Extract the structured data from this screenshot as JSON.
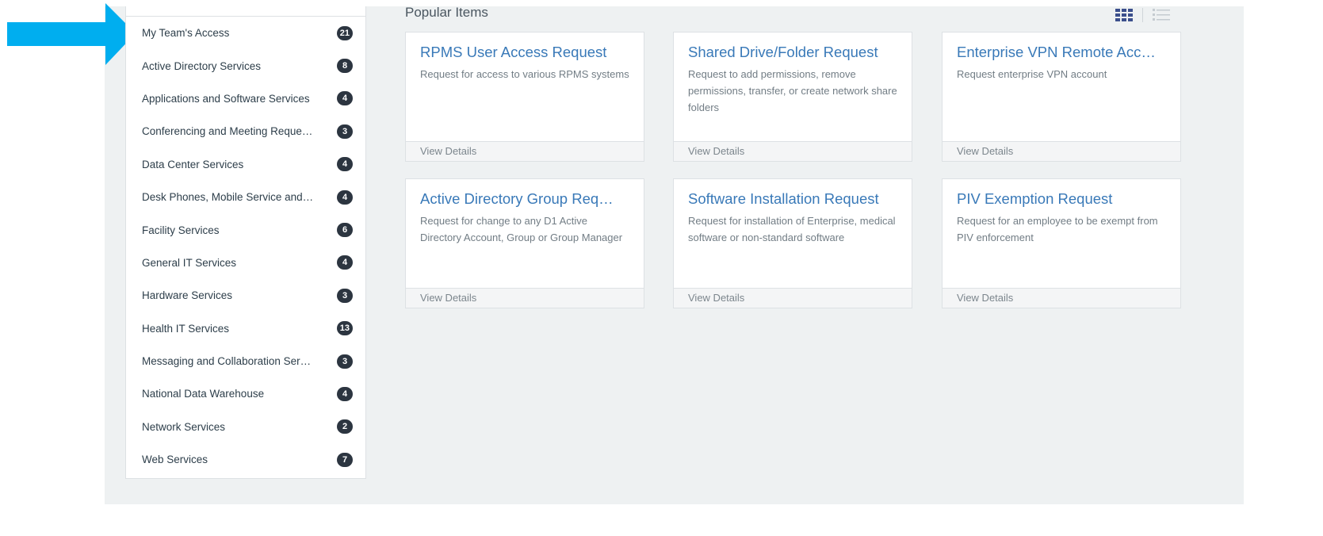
{
  "sidebar": {
    "items": [
      {
        "label": "My Team's Access",
        "count": "21"
      },
      {
        "label": "Active Directory Services",
        "count": "8"
      },
      {
        "label": "Applications and Software Services",
        "count": "4"
      },
      {
        "label": "Conferencing and Meeting Reque…",
        "count": "3"
      },
      {
        "label": "Data Center Services",
        "count": "4"
      },
      {
        "label": "Desk Phones, Mobile Service and…",
        "count": "4"
      },
      {
        "label": "Facility Services",
        "count": "6"
      },
      {
        "label": "General IT Services",
        "count": "4"
      },
      {
        "label": "Hardware Services",
        "count": "3"
      },
      {
        "label": "Health IT Services",
        "count": "13"
      },
      {
        "label": "Messaging and Collaboration Ser…",
        "count": "3"
      },
      {
        "label": "National Data Warehouse",
        "count": "4"
      },
      {
        "label": "Network Services",
        "count": "2"
      },
      {
        "label": "Web Services",
        "count": "7"
      }
    ]
  },
  "main": {
    "title": "Popular Items",
    "cards": [
      {
        "title": "RPMS User Access Request",
        "description": "Request for access to various RPMS systems",
        "footer": "View Details"
      },
      {
        "title": "Shared Drive/Folder Request",
        "description": "Request to add permissions, remove permissions, transfer, or create network share folders",
        "footer": "View Details"
      },
      {
        "title": "Enterprise VPN Remote Acc…",
        "description": "Request enterprise VPN account",
        "footer": "View Details"
      },
      {
        "title": "Active Directory Group Req…",
        "description": "Request for change to any D1 Active Directory Account, Group or Group Manager",
        "footer": "View Details"
      },
      {
        "title": "Software Installation Request",
        "description": "Request for installation of Enterprise, medical software or non-standard software",
        "footer": "View Details"
      },
      {
        "title": "PIV Exemption Request",
        "description": "Request for an employee to be exempt from PIV enforcement",
        "footer": "View Details"
      }
    ]
  },
  "icons": {
    "arrow": "pointer-arrow-icon",
    "tile_view": "grid-view-icon",
    "list_view": "list-view-icon"
  },
  "colors": {
    "arrow": "#00aeef",
    "link": "#3979b8",
    "badge": "#2c3540",
    "background": "#eef1f2",
    "active_view": "#3b4f8c"
  }
}
